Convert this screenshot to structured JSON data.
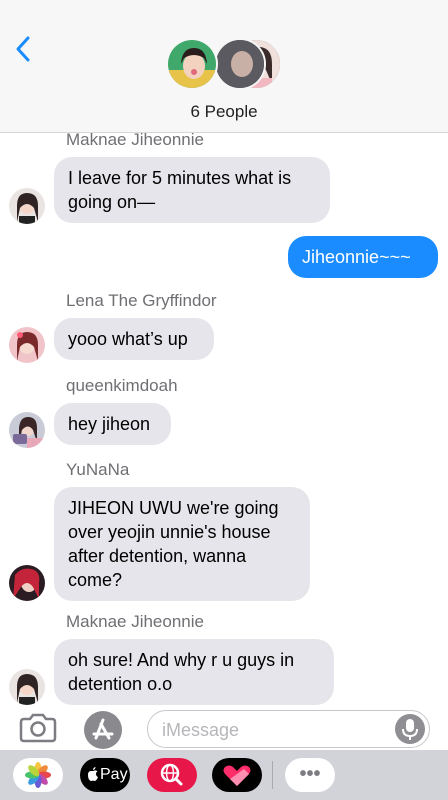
{
  "header": {
    "title": "6 People"
  },
  "messages": [
    {
      "sender": "Maknae Jiheonnie",
      "lines": [
        "I leave for 5 minutes what is",
        "going on—"
      ]
    },
    {
      "outgoing": "Jiheonnie~~~"
    },
    {
      "sender": "Lena The Gryffindor",
      "lines": [
        "yooo what’s up"
      ]
    },
    {
      "sender": "queenkimdoah",
      "lines": [
        "hey jiheon"
      ]
    },
    {
      "sender": "YuNaNa",
      "lines": [
        "JIHEON UWU we're going",
        "over yeojin unnie's house",
        "after detention, wanna",
        "come?"
      ]
    },
    {
      "sender": "Maknae Jiheonnie",
      "lines": [
        "oh sure! And why r u guys in",
        "detention o.o"
      ]
    }
  ],
  "input": {
    "placeholder": "iMessage"
  },
  "drawer": {
    "apple_pay_label": "Pay",
    "more_label": "•••"
  },
  "colors": {
    "accent": "#1a8cff",
    "incoming_bubble": "#e6e5eb",
    "heart_app": "#e8174a"
  },
  "icons": [
    "back-chevron-icon",
    "camera-icon",
    "app-store-icon",
    "microphone-icon",
    "photos-icon",
    "apple-pay-icon",
    "search-globe-icon",
    "heart-icon",
    "more-icon"
  ]
}
